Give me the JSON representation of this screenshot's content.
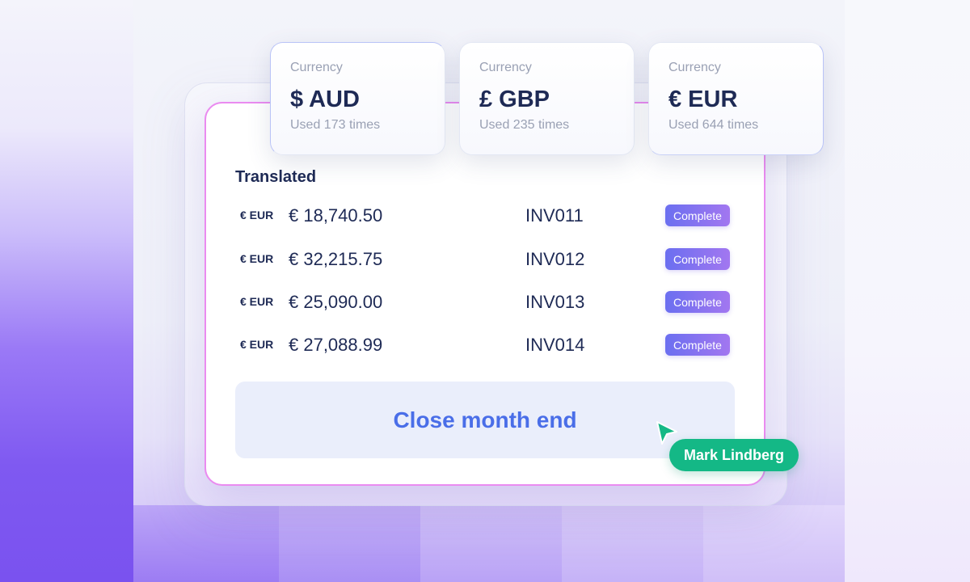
{
  "currencies": [
    {
      "caption": "Currency",
      "value": "$ AUD",
      "usage": "Used 173 times"
    },
    {
      "caption": "Currency",
      "value": "£ GBP",
      "usage": "Used 235 times"
    },
    {
      "caption": "Currency",
      "value": "€ EUR",
      "usage": "Used 644 times"
    }
  ],
  "table": {
    "title": "Translated",
    "rows": [
      {
        "code": "€ EUR",
        "amount": "€ 18,740.50",
        "invoice": "INV011",
        "status": "Complete"
      },
      {
        "code": "€ EUR",
        "amount": "€ 32,215.75",
        "invoice": "INV012",
        "status": "Complete"
      },
      {
        "code": "€ EUR",
        "amount": "€ 25,090.00",
        "invoice": "INV013",
        "status": "Complete"
      },
      {
        "code": "€ EUR",
        "amount": "€ 27,088.99",
        "invoice": "INV014",
        "status": "Complete"
      }
    ]
  },
  "action": {
    "label": "Close month end"
  },
  "collaborator": {
    "name": "Mark Lindberg",
    "color": "#14b886",
    "icon": "pointer-cursor-icon"
  },
  "colors": {
    "badge_start": "#6b6ff0",
    "badge_end": "#a277f0",
    "button_text": "#4a6ee8",
    "card_border": "#ea8bf0",
    "heading": "#1e2a55"
  }
}
